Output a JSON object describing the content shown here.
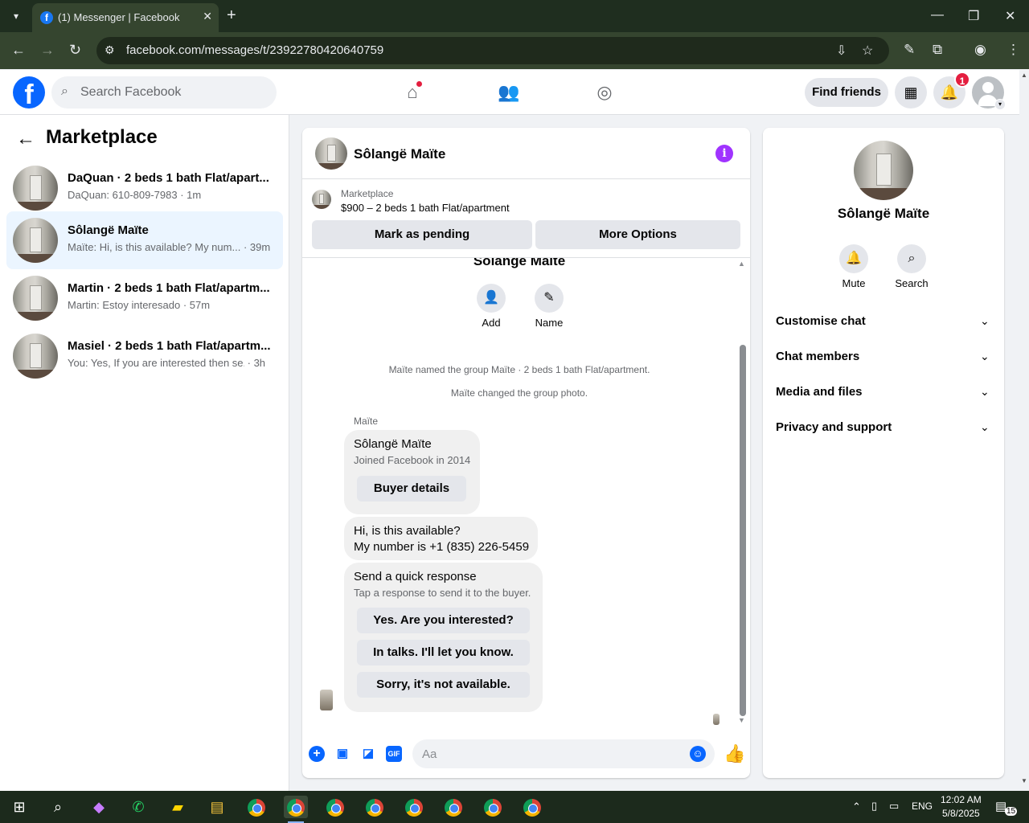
{
  "browser": {
    "tab_title": "(1) Messenger | Facebook",
    "url": "facebook.com/messages/t/23922780420640759"
  },
  "fb_header": {
    "search_placeholder": "Search Facebook",
    "find_friends_label": "Find friends",
    "notification_count": "1"
  },
  "left_panel": {
    "title": "Marketplace",
    "conversations": [
      {
        "name": "DaQuan · 2 beds 1 bath Flat/apart...",
        "preview": "DaQuan: 610-809-7983",
        "time": "· 1m",
        "active": false
      },
      {
        "name": "Sôlangë Maïte",
        "preview": "Maïte: Hi, is this available? My num...",
        "time": "· 39m",
        "active": true
      },
      {
        "name": "Martin · 2 beds 1 bath Flat/apartm...",
        "preview": "Martin: Estoy interesado",
        "time": "· 57m",
        "active": false
      },
      {
        "name": "Masiel · 2 beds 1 bath Flat/apartm...",
        "preview": "You: Yes, If you are interested then se...",
        "time": "· 3h",
        "active": false
      }
    ]
  },
  "chat": {
    "header_name": "Sôlangë Maïte",
    "listing_label": "Marketplace",
    "listing_price": "$900 – 2 beds 1 bath Flat/apartment",
    "mark_pending_label": "Mark as pending",
    "more_options_label": "More Options",
    "top_name": "Sôlangë Maïte",
    "add_label": "Add",
    "name_label": "Name",
    "system_messages": [
      "Maïte named the group Maïte · 2 beds 1 bath Flat/apartment.",
      "Maïte changed the group photo."
    ],
    "sender": "Maïte",
    "buyer_card": {
      "name": "Sôlangë Maïte",
      "joined": "Joined Facebook in 2014",
      "button": "Buyer details"
    },
    "message": {
      "line1": "Hi, is this available?",
      "line2": "My number is +1 (835) 226-5459"
    },
    "quick_response": {
      "title": "Send a quick response",
      "subtitle": "Tap a response to send it to the buyer.",
      "options": [
        "Yes. Are you interested?",
        "In talks. I'll let you know.",
        "Sorry, it's not available."
      ]
    },
    "composer_placeholder": "Aa"
  },
  "right_panel": {
    "name": "Sôlangë Maïte",
    "mute_label": "Mute",
    "search_label": "Search",
    "sections": [
      "Customise chat",
      "Chat members",
      "Media and files",
      "Privacy and support"
    ]
  },
  "taskbar": {
    "lang": "ENG",
    "time": "12:02 AM",
    "date": "5/8/2025",
    "notif_count": "15"
  },
  "colors": {
    "fb_blue": "#0866ff",
    "active_conv_bg": "#ebf5ff",
    "info_purple": "#a033ff",
    "badge_red": "#e41e3f"
  }
}
